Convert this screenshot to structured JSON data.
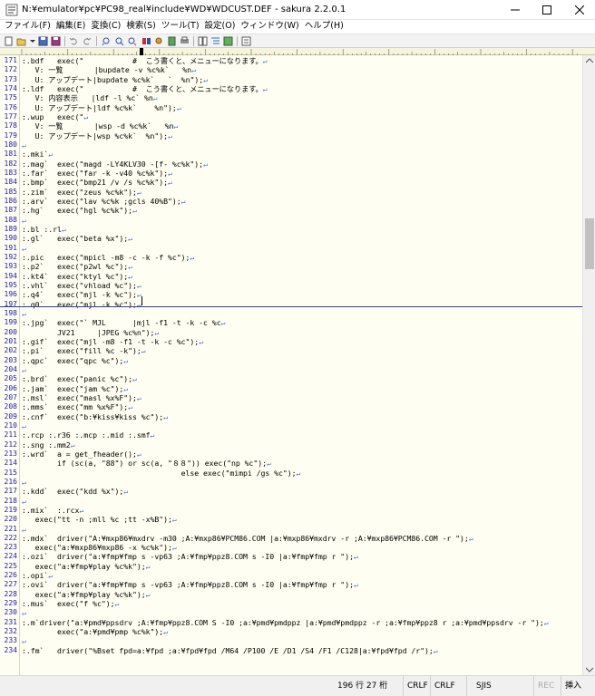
{
  "window": {
    "title": "N:¥emulator¥pc¥PC98_real¥include¥WD¥WDCUST.DEF - sakura 2.2.0.1"
  },
  "menu": [
    {
      "label": "ファイル(F)"
    },
    {
      "label": "編集(E)"
    },
    {
      "label": "変換(C)"
    },
    {
      "label": "検索(S)"
    },
    {
      "label": "ツール(T)"
    },
    {
      "label": "設定(O)"
    },
    {
      "label": "ウィンドウ(W)"
    },
    {
      "label": "ヘルプ(H)"
    }
  ],
  "toolbar": {
    "icons": [
      "new-file-icon",
      "open-file-icon",
      "open-dropdown-icon",
      "save-icon",
      "save-all-icon",
      "undo-icon",
      "redo-icon",
      "search-prev-icon",
      "search-icon",
      "search-next-icon",
      "replace-icon",
      "grep-icon",
      "bookmark-icon",
      "print-icon",
      "compare-icon",
      "outline-icon",
      "settings-icon"
    ]
  },
  "editor": {
    "eol_mark": "↵",
    "lines": [
      {
        "no": "171",
        "text": ":.bdf   exec(\"           #  こう書くと、メニューになります。",
        "eol": true
      },
      {
        "no": "172",
        "text": "   V: 一覧       |bupdate -v %c%k`   %n",
        "eol": true
      },
      {
        "no": "173",
        "text": "   U: アップデート|bupdate %c%k`   `  %n\");",
        "eol": true
      },
      {
        "no": "174",
        "text": ":.ldf   exec(\"           #  こう書くと、メニューになります。",
        "eol": true
      },
      {
        "no": "175",
        "text": "   V: 内容表示   |ldf -l %c` %n",
        "eol": true
      },
      {
        "no": "176",
        "text": "   U: アップデート|ldf %c%k`    %n\");",
        "eol": true
      },
      {
        "no": "177",
        "text": ":.wup   exec(\"",
        "eol": true
      },
      {
        "no": "178",
        "text": "   V: 一覧       |wsp -d %c%k`   %n",
        "eol": true
      },
      {
        "no": "179",
        "text": "   U: アップデート|wsp %c%k`  %n\");",
        "eol": true
      },
      {
        "no": "180",
        "text": "",
        "eol": true
      },
      {
        "no": "181",
        "text": ":.mki`",
        "eol": true
      },
      {
        "no": "182",
        "text": ":.mag`  exec(\"magd -LY4KLV30 -[f- %c%k\");",
        "eol": true
      },
      {
        "no": "183",
        "text": ":.far`  exec(\"far -k -v40 %c%k\");",
        "eol": true
      },
      {
        "no": "184",
        "text": ":.bmp`  exec(\"bmp21 /v /s %c%k\");",
        "eol": true
      },
      {
        "no": "185",
        "text": ":.zim`  exec(\"zeus %c%k\");",
        "eol": true
      },
      {
        "no": "186",
        "text": ":.arv`  exec(\"lav %c%k ;gcls 40%B\");",
        "eol": true
      },
      {
        "no": "187",
        "text": ":.hg`   exec(\"hgl %c%k\");",
        "eol": true
      },
      {
        "no": "188",
        "text": "",
        "eol": true
      },
      {
        "no": "189",
        "text": ":.bl :.rl",
        "eol": true
      },
      {
        "no": "190",
        "text": ":.gl`   exec(\"beta %x\");",
        "eol": true
      },
      {
        "no": "191",
        "text": "",
        "eol": true
      },
      {
        "no": "192",
        "text": ":.pic   exec(\"mpicl -m8 -c -k -f %c\");",
        "eol": true
      },
      {
        "no": "193",
        "text": ":.p2`   exec(\"p2wl %c\");",
        "eol": true
      },
      {
        "no": "194",
        "text": ":.kt4`  exec(\"ktyl %c\");",
        "eol": true
      },
      {
        "no": "195",
        "text": ":.vhl`  exec(\"vhload %c\");",
        "eol": true
      },
      {
        "no": "196",
        "text": ":.q4`   exec(\"mjl -k %c\");",
        "eol": true
      },
      {
        "no": "197",
        "text": ":.q0`   exec(\"mjl -k %c\");",
        "eol": true
      },
      {
        "no": "198",
        "text": "",
        "eol": true
      },
      {
        "no": "199",
        "text": ":.jpg`  exec(\"` MJL      |mjl -f1 -t -k -c %c",
        "eol": true
      },
      {
        "no": "200",
        "text": "        JV21     |JPEG %c%n\");",
        "eol": true
      },
      {
        "no": "201",
        "text": ":.gif`  exec(\"mjl -m8 -f1 -t -k -c %c\");",
        "eol": true
      },
      {
        "no": "202",
        "text": ":.pi`   exec(\"fill %c -k\");",
        "eol": true
      },
      {
        "no": "203",
        "text": ":.qpc`  exec(\"qpc %c\");",
        "eol": true
      },
      {
        "no": "204",
        "text": "",
        "eol": true
      },
      {
        "no": "205",
        "text": ":.brd`  exec(\"panic %c\");",
        "eol": true
      },
      {
        "no": "206",
        "text": ":.jam`  exec(\"jam %c\");",
        "eol": true
      },
      {
        "no": "207",
        "text": ":.msl`  exec(\"masl %x%F\");",
        "eol": true
      },
      {
        "no": "208",
        "text": ":.mms`  exec(\"mm %x%F\");",
        "eol": true
      },
      {
        "no": "209",
        "text": ":.cnf`  exec(\"b:¥kiss¥kiss %c\");",
        "eol": true
      },
      {
        "no": "210",
        "text": "",
        "eol": true
      },
      {
        "no": "211",
        "text": ":.rcp :.r36 :.mcp :.mid :.smf",
        "eol": true
      },
      {
        "no": "212",
        "text": ":.sng :.mm2",
        "eol": true
      },
      {
        "no": "213",
        "text": ":.wrd`  a = get_fheader();",
        "eol": true
      },
      {
        "no": "214",
        "text": "        if (sc(a, \"88\") or sc(a, \"８８\")) exec(\"np %c\");",
        "eol": true
      },
      {
        "no": "215",
        "text": "                                    else exec(\"mimpi /gs %c\");",
        "eol": true
      },
      {
        "no": "216",
        "text": "",
        "eol": true
      },
      {
        "no": "217",
        "text": ":.kdd`  exec(\"kdd %x\");",
        "eol": true
      },
      {
        "no": "218",
        "text": "",
        "eol": true
      },
      {
        "no": "219",
        "text": ":.mix`  :.rcx",
        "eol": true
      },
      {
        "no": "220",
        "text": "   exec(\"tt -n ;mll %c ;tt -x%B\");",
        "eol": true
      },
      {
        "no": "221",
        "text": "",
        "eol": true
      },
      {
        "no": "222",
        "text": ":.mdx`  driver(\"A:¥mxp86¥mxdrv -m30 ;A:¥mxp86¥PCM86.COM |a:¥mxp86¥mxdrv -r ;A:¥mxp86¥PCM86.COM -r \");",
        "eol": true
      },
      {
        "no": "223",
        "text": "   exec(\"a:¥mxp86¥mxp86 -x %c%k\");",
        "eol": true
      },
      {
        "no": "224",
        "text": ":.ozi`  driver(\"a:¥fmp¥fmp s -vp63 ;A:¥fmp¥ppz8.COM s -I0 |a:¥fmp¥fmp r \");",
        "eol": true
      },
      {
        "no": "225",
        "text": "   exec(\"a:¥fmp¥play %c%k\");",
        "eol": true
      },
      {
        "no": "226",
        "text": ":.opi`",
        "eol": true
      },
      {
        "no": "227",
        "text": ":.ovi`  driver(\"a:¥fmp¥fmp s -vp63 ;A:¥fmp¥ppz8.COM s -I0 |a:¥fmp¥fmp r \");",
        "eol": true
      },
      {
        "no": "228",
        "text": "   exec(\"a:¥fmp¥play %c%k\");",
        "eol": true
      },
      {
        "no": "229",
        "text": ":.mus`  exec(\"f %c\");",
        "eol": true
      },
      {
        "no": "230",
        "text": "",
        "eol": true
      },
      {
        "no": "231",
        "text": ":.m`driver(\"a:¥pmd¥ppsdrv ;A:¥fmp¥ppz8.COM S -I0 ;a:¥pmd¥pmdppz |a:¥pmd¥pmdppz -r ;a:¥fmp¥ppz8 r ;a:¥pmd¥ppsdrv -r \");",
        "eol": true
      },
      {
        "no": "232",
        "text": "        exec(\"a:¥pmd¥pmp %c%k\");",
        "eol": true
      },
      {
        "no": "233",
        "text": "",
        "eol": true
      },
      {
        "no": "234",
        "text": ":.fm`   driver(\"%Bset fpd=a:¥fpd ;a:¥fpd¥fpd /M64 /P100 /E /D1 /S4 /F1 /C128|a:¥fpd¥fpd /r\");",
        "eol": true
      }
    ]
  },
  "statusbar": {
    "position": "196 行  27 桁",
    "eol1": "CRLF",
    "eol2": "CRLF",
    "encoding": "SJIS",
    "rec": "REC",
    "mode": "挿入"
  },
  "colors": {
    "editor_bg": "#fffef2",
    "line_number": "#2020a8",
    "eol_mark": "#3c78c8",
    "cursor_line": "#2a3db0"
  }
}
